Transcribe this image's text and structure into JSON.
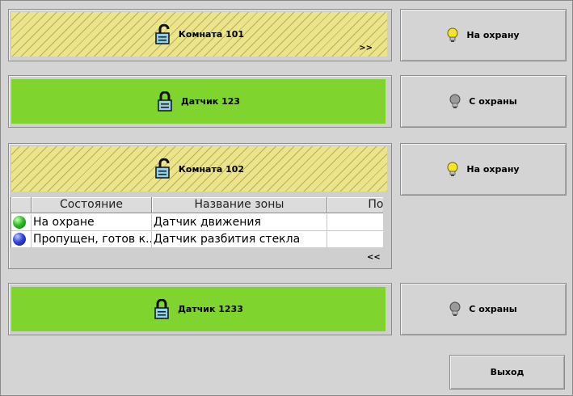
{
  "zones": [
    {
      "name": "Комната 101",
      "style": "hatch",
      "lock": "open",
      "expander": ">>"
    },
    {
      "name": "Датчик 123",
      "style": "green",
      "lock": "closed"
    },
    {
      "name": "Комната 102",
      "style": "hatch",
      "lock": "open",
      "expander": "<<"
    },
    {
      "name": "Датчик 1233",
      "style": "green",
      "lock": "closed"
    }
  ],
  "actions": [
    {
      "label": "На охрану",
      "bulb": "on"
    },
    {
      "label": "С охраны",
      "bulb": "off"
    },
    {
      "label": "На охрану",
      "bulb": "on"
    },
    {
      "label": "С охраны",
      "bulb": "off"
    }
  ],
  "table": {
    "columns": [
      "",
      "Состояние",
      "Название зоны",
      "Пом"
    ],
    "rows": [
      {
        "status_color": "green",
        "state": "На охране",
        "zone": "Датчик движения",
        "room": ""
      },
      {
        "status_color": "blue",
        "state": "Пропущен, готов к...",
        "zone": "Датчик разбития стекла",
        "room": ""
      }
    ]
  },
  "exit_label": "Выход",
  "colors": {
    "hatch_bg": "#ece48a",
    "armed_green": "#7fd52d",
    "bulb_on": "#f5e52a",
    "bulb_off": "#9a9a9a",
    "lock_blue": "#8fd0e6"
  },
  "icons": {
    "lock_open": "open-padlock-icon",
    "lock_closed": "closed-padlock-icon",
    "bulb_on": "lit-lightbulb-icon",
    "bulb_off": "unlit-lightbulb-icon",
    "status": "status-ball-icon"
  }
}
